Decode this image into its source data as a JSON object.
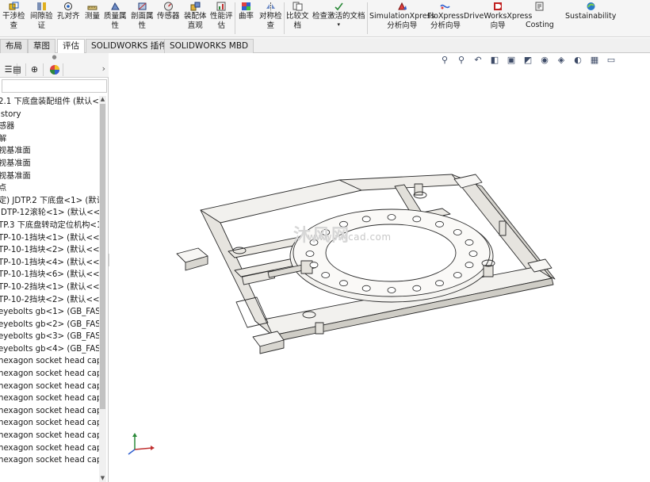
{
  "ribbon": {
    "buttons": [
      {
        "label": "干涉检\n查",
        "icon": "interference-check-icon"
      },
      {
        "label": "间隙验\n证",
        "icon": "clearance-verification-icon"
      },
      {
        "label": "孔对齐",
        "icon": "hole-alignment-icon"
      },
      {
        "label": "测量",
        "icon": "measure-icon"
      },
      {
        "label": "质量属\n性",
        "icon": "mass-properties-icon"
      },
      {
        "label": "剖面属\n性",
        "icon": "section-properties-icon"
      },
      {
        "label": "传感器",
        "icon": "sensor-icon"
      },
      {
        "label": "装配体\n直观",
        "icon": "assemblyxpert-icon"
      },
      {
        "label": "性能评\n估",
        "icon": "performance-evaluation-icon"
      },
      {
        "label": "曲率",
        "icon": "curvature-icon"
      },
      {
        "label": "对称检\n查",
        "icon": "symmetry-check-icon"
      },
      {
        "label": "比较文\n档",
        "icon": "compare-documents-icon"
      },
      {
        "label": "检查激活的文档",
        "icon": "check-active-document-icon"
      },
      {
        "label": "SimulationXpress\n分析向导",
        "icon": "simulationxpress-icon"
      },
      {
        "label": "FloXpress\n分析向导",
        "icon": "floxpress-icon"
      },
      {
        "label": "DriveWorksXpress\n向导",
        "icon": "driveworksxpress-icon"
      },
      {
        "label": "Costing",
        "icon": "costing-icon"
      },
      {
        "label": "Sustainability",
        "icon": "sustainability-icon"
      }
    ]
  },
  "tabs": [
    "布局",
    "草图",
    "评估",
    "SOLIDWORKS 插件",
    "SOLIDWORKS MBD"
  ],
  "active_tab": "评估",
  "tree": {
    "nodes": [
      "2.1 下底盘装配组件  (默认<默",
      "istory",
      "感器",
      "解",
      "视基准面",
      "视基准面",
      "视基准面",
      "点",
      "定) JDTP.2 下底盘<1> (默认",
      "JDTP-12滚轮<1> (默认<<默",
      "TP.3 下底盘转动定位机构<1>",
      "TP-10-1挡块<1> (默认<<默",
      "TP-10-1挡块<2> (默认<<默",
      "TP-10-1挡块<4> (默认<<默",
      "TP-10-1挡块<6> (默认<<默",
      "TP-10-2挡块<1> (默认<<默",
      "TP-10-2挡块<2> (默认<<默",
      "eyebolts gb<1> (GB_FAST",
      "eyebolts gb<2> (GB_FAST",
      "eyebolts gb<3> (GB_FAST",
      "eyebolts gb<4> (GB_FAST",
      "hexagon socket head cap s",
      "hexagon socket head cap s",
      "hexagon socket head cap s",
      "hexagon socket head cap s",
      "hexagon socket head cap s",
      "hexagon socket head cap s",
      "hexagon socket head cap s",
      "hexagon socket head cap s",
      "hexagon socket head cap s"
    ]
  },
  "viewport": {
    "watermark": "www.mfcad.com",
    "watermark_logo_text": "沐风网",
    "hud_icons": [
      "zoom-to-fit-icon",
      "zoom-area-icon",
      "previous-view-icon",
      "section-view-icon",
      "view-orientation-icon",
      "display-style-icon",
      "hide-show-icon",
      "edit-appearance-icon",
      "apply-scene-icon",
      "view-settings-icon",
      "monitor-icon"
    ]
  },
  "colors": {
    "ribbon_bg": "#f5f5f5",
    "accent_blue": "#1f5fbf",
    "part_fill": "#eeece8",
    "part_edge": "#2b2b2b"
  }
}
